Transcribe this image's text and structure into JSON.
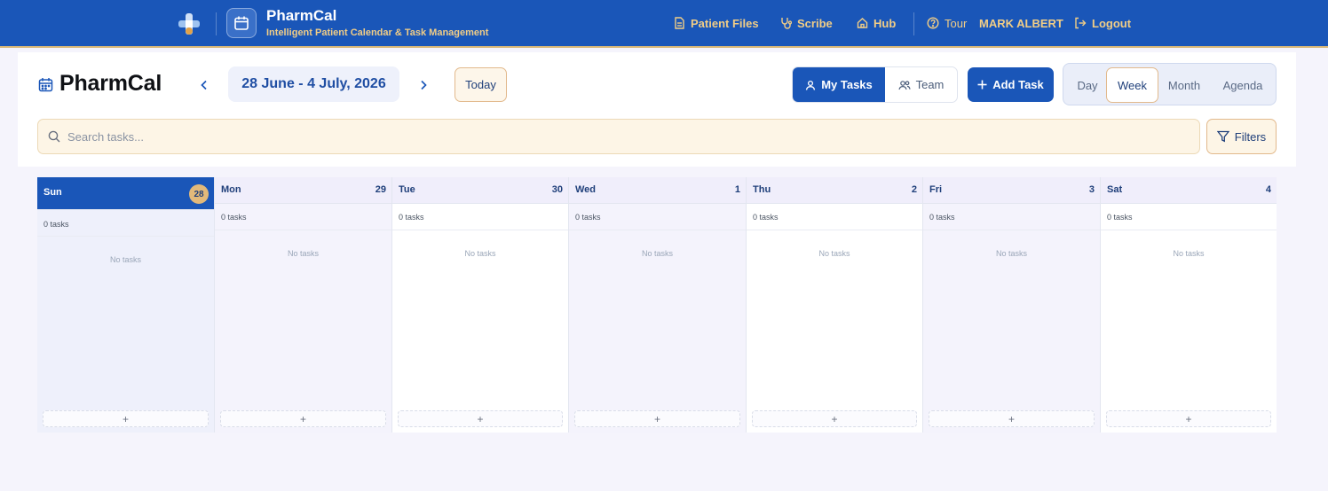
{
  "brand": {
    "title": "PharmCal",
    "subtitle": "Intelligent Patient Calendar & Task Management"
  },
  "nav": {
    "patient_files": "Patient Files",
    "scribe": "Scribe",
    "hub": "Hub",
    "tour": "Tour",
    "user": "MARK ALBERT",
    "logout": "Logout"
  },
  "header": {
    "title": "PharmCal",
    "range": "28 June - 4 July, 2026",
    "today": "Today",
    "my_tasks": "My Tasks",
    "team": "Team",
    "add_task": "Add Task",
    "views": [
      "Day",
      "Week",
      "Month",
      "Agenda"
    ],
    "active_view": "Week",
    "search_placeholder": "Search tasks...",
    "filters": "Filters"
  },
  "week": [
    {
      "name": "Sun",
      "num": "28",
      "count": "0 tasks",
      "empty": "No tasks",
      "add": "+"
    },
    {
      "name": "Mon",
      "num": "29",
      "count": "0 tasks",
      "empty": "No tasks",
      "add": "+"
    },
    {
      "name": "Tue",
      "num": "30",
      "count": "0 tasks",
      "empty": "No tasks",
      "add": "+"
    },
    {
      "name": "Wed",
      "num": "1",
      "count": "0 tasks",
      "empty": "No tasks",
      "add": "+"
    },
    {
      "name": "Thu",
      "num": "2",
      "count": "0 tasks",
      "empty": "No tasks",
      "add": "+"
    },
    {
      "name": "Fri",
      "num": "3",
      "count": "0 tasks",
      "empty": "No tasks",
      "add": "+"
    },
    {
      "name": "Sat",
      "num": "4",
      "count": "0 tasks",
      "empty": "No tasks",
      "add": "+"
    }
  ],
  "colors": {
    "primary": "#1a56b8",
    "accent_gold": "#f1cd86",
    "today_badge": "#e2b97a"
  }
}
